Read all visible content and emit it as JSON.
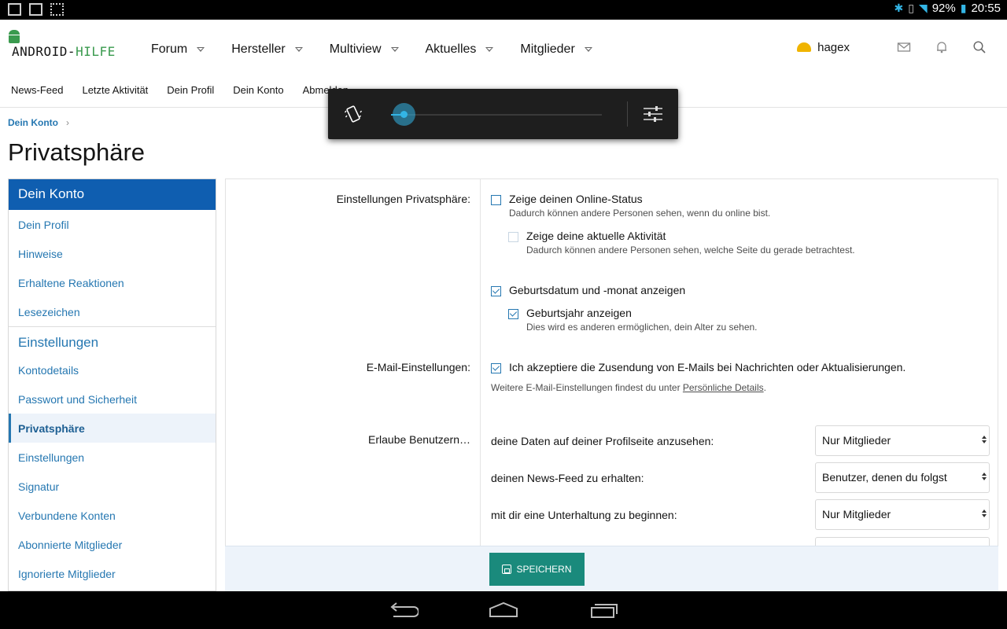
{
  "status_bar": {
    "battery": "92%",
    "time": "20:55"
  },
  "header": {
    "logo_part1": "ANDROID-",
    "logo_part2": "HILFE",
    "nav": [
      {
        "label": "Forum"
      },
      {
        "label": "Hersteller"
      },
      {
        "label": "Multiview"
      },
      {
        "label": "Aktuelles"
      },
      {
        "label": "Mitglieder"
      }
    ],
    "username": "hagex",
    "subnav": [
      "News-Feed",
      "Letzte Aktivität",
      "Dein Profil",
      "Dein Konto",
      "Abmelden"
    ]
  },
  "volume_popup": {
    "level": 0.06
  },
  "breadcrumb": {
    "item": "Dein Konto"
  },
  "page_title": "Privatsphäre",
  "sidebar": {
    "heading": "Dein Konto",
    "items_top": [
      "Dein Profil",
      "Hinweise",
      "Erhaltene Reaktionen",
      "Lesezeichen"
    ],
    "group": "Einstellungen",
    "items_bottom": [
      "Kontodetails",
      "Passwort und Sicherheit",
      "Privatsphäre",
      "Einstellungen",
      "Signatur",
      "Verbundene Konten",
      "Abonnierte Mitglieder",
      "Ignorierte Mitglieder"
    ],
    "active": "Privatsphäre"
  },
  "form": {
    "privacy_label": "Einstellungen Privatsphäre:",
    "online_status": {
      "label": "Zeige deinen Online-Status",
      "hint": "Dadurch können andere Personen sehen, wenn du online bist.",
      "checked": false
    },
    "activity": {
      "label": "Zeige deine aktuelle Aktivität",
      "hint": "Dadurch können andere Personen sehen, welche Seite du gerade betrachtest.",
      "checked": false
    },
    "birthday": {
      "label": "Geburtsdatum und -monat anzeigen",
      "checked": true
    },
    "birthyear": {
      "label": "Geburtsjahr anzeigen",
      "hint": "Dies wird es anderen ermöglichen, dein Alter zu sehen.",
      "checked": true
    },
    "email_label": "E-Mail-Einstellungen:",
    "email_opt": {
      "label": "Ich akzeptiere die Zusendung von E-Mails bei Nachrichten oder Aktualisierungen.",
      "checked": true
    },
    "email_note_prefix": "Weitere E-Mail-Einstellungen findest du unter ",
    "email_note_link": "Persönliche Details",
    "email_note_suffix": ".",
    "allow_label": "Erlaube Benutzern…",
    "allow_rows": [
      {
        "text": "deine Daten auf deiner Profilseite anzusehen:",
        "value": "Nur Mitglieder"
      },
      {
        "text": "deinen News-Feed zu erhalten:",
        "value": "Benutzer, denen du folgst"
      },
      {
        "text": "mit dir eine Unterhaltung zu beginnen:",
        "value": "Nur Mitglieder"
      }
    ],
    "save_label": "SPEICHERN"
  }
}
